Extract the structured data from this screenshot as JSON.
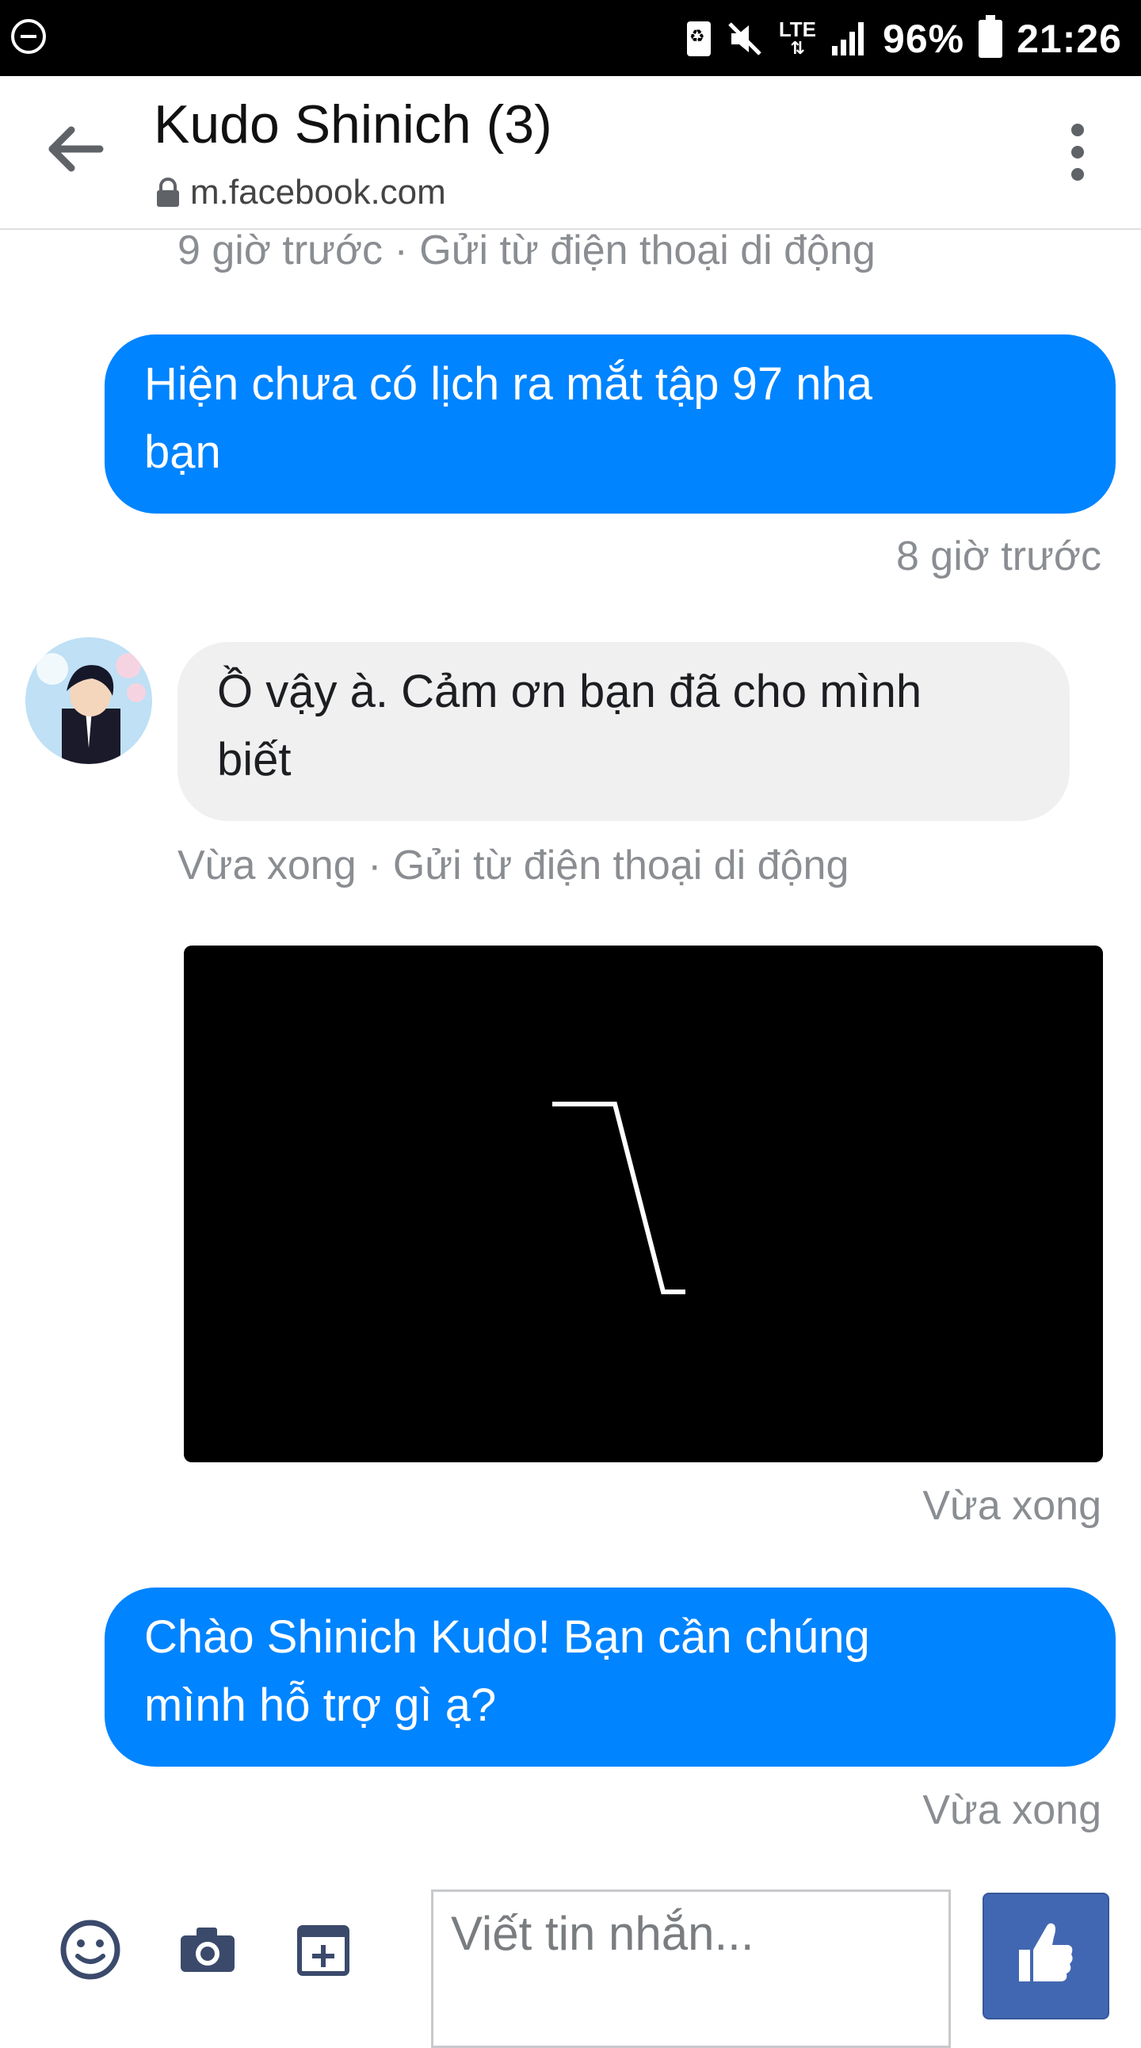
{
  "status_bar": {
    "battery": "96%",
    "time": "21:26",
    "network": "LTE"
  },
  "header": {
    "title": "Kudo Shinich (3)",
    "url": "m.facebook.com"
  },
  "messages": [
    {
      "meta": "9 giờ trước · Gửi từ điện thoại di động"
    },
    {
      "text_line1": "Hiện chưa có lịch ra mắt tập 97 nha",
      "text_line2": "bạn",
      "time": "8 giờ trước"
    },
    {
      "text_line1": "Ồ vậy à. Cảm ơn bạn đã cho mình",
      "text_line2": "biết",
      "meta": "Vừa xong · Gửi từ điện thoại di động"
    },
    {
      "time": "Vừa xong"
    },
    {
      "text_line1": "Chào Shinich Kudo! Bạn cần chúng",
      "text_line2": "mình hỗ trợ gì ạ?",
      "time": "Vừa xong"
    }
  ],
  "composer": {
    "placeholder": "Viết tin nhắn..."
  }
}
